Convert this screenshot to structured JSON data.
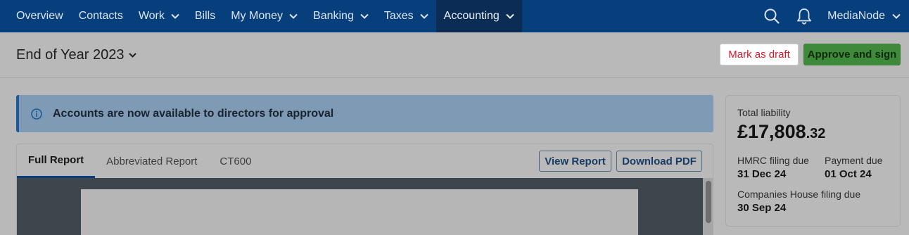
{
  "nav": {
    "items": [
      {
        "label": "Overview",
        "has_dropdown": false,
        "active": false
      },
      {
        "label": "Contacts",
        "has_dropdown": false,
        "active": false
      },
      {
        "label": "Work",
        "has_dropdown": true,
        "active": false
      },
      {
        "label": "Bills",
        "has_dropdown": false,
        "active": false
      },
      {
        "label": "My Money",
        "has_dropdown": true,
        "active": false
      },
      {
        "label": "Banking",
        "has_dropdown": true,
        "active": false
      },
      {
        "label": "Taxes",
        "has_dropdown": true,
        "active": false
      },
      {
        "label": "Accounting",
        "has_dropdown": true,
        "active": true
      }
    ],
    "user": "MediaNode",
    "icons": [
      "search-icon",
      "bell-icon"
    ]
  },
  "header": {
    "title": "End of Year 2023",
    "mark_draft_label": "Mark as draft",
    "approve_label": "Approve and sign"
  },
  "banner": {
    "text": "Accounts are now available to directors for approval"
  },
  "report": {
    "tabs": [
      {
        "label": "Full Report",
        "active": true
      },
      {
        "label": "Abbreviated Report",
        "active": false
      },
      {
        "label": "CT600",
        "active": false
      }
    ],
    "view_label": "View Report",
    "download_label": "Download PDF"
  },
  "liability": {
    "label": "Total liability",
    "amount_main": "£17,808",
    "amount_pence": ".32",
    "hmrc_label": "HMRC filing due",
    "hmrc_value": "31 Dec 24",
    "payment_label": "Payment due",
    "payment_value": "01 Oct 24",
    "ch_label": "Companies House filing due",
    "ch_value": "30 Sep 24"
  },
  "colors": {
    "nav_bg": "#073f7d",
    "nav_active_bg": "#0a2c55",
    "approve_green": "#3f8a3a",
    "draft_red": "#d5182a",
    "banner_bg": "#7f9ab4"
  }
}
